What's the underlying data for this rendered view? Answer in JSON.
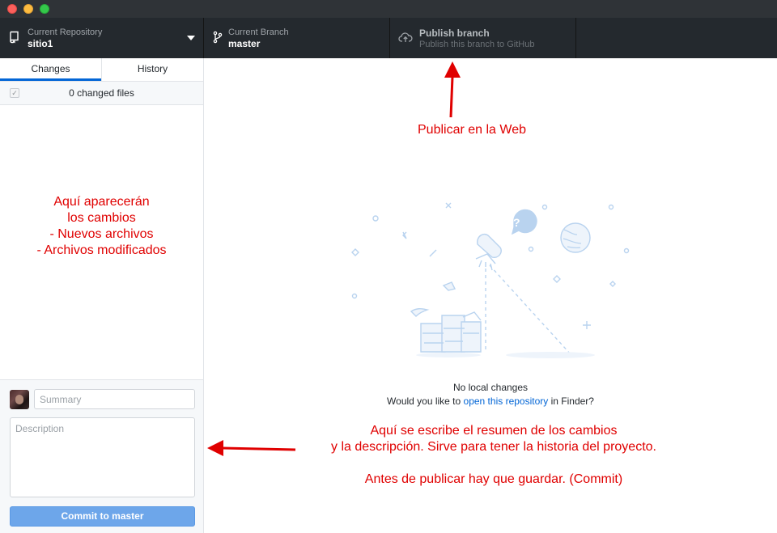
{
  "toolbar": {
    "repo": {
      "label": "Current Repository",
      "value": "sitio1",
      "icon": "repo-icon"
    },
    "branch": {
      "label": "Current Branch",
      "value": "master",
      "icon": "git-branch-icon"
    },
    "publish": {
      "label": "Publish branch",
      "description": "Publish this branch to GitHub",
      "icon": "cloud-upload-icon"
    }
  },
  "sidebar": {
    "tabs": [
      {
        "label": "Changes",
        "active": true
      },
      {
        "label": "History",
        "active": false
      }
    ],
    "changed_files": "0 changed files",
    "annotation_lines": [
      "Aquí aparecerán",
      "los cambios",
      "- Nuevos archivos",
      "- Archivos modificados"
    ]
  },
  "commit": {
    "summary_placeholder": "Summary",
    "description_placeholder": "Description",
    "button_prefix": "Commit to ",
    "button_branch": "master"
  },
  "main": {
    "title": "No local changes",
    "prompt_before": "Would you like to ",
    "prompt_link": "open this repository",
    "prompt_after": " in Finder?"
  },
  "annotations": {
    "publish": "Publicar en la Web",
    "commit_lines": [
      "Aquí se escribe el resumen de los cambios",
      "y la descripción. Sirve para tener la historia del proyecto.",
      "",
      "Antes de publicar hay que guardar. (Commit)"
    ]
  },
  "colors": {
    "annotation": "#e00000",
    "link": "#0366d6",
    "toolbar": "#24292e",
    "commit_button": "#6da6ea"
  }
}
